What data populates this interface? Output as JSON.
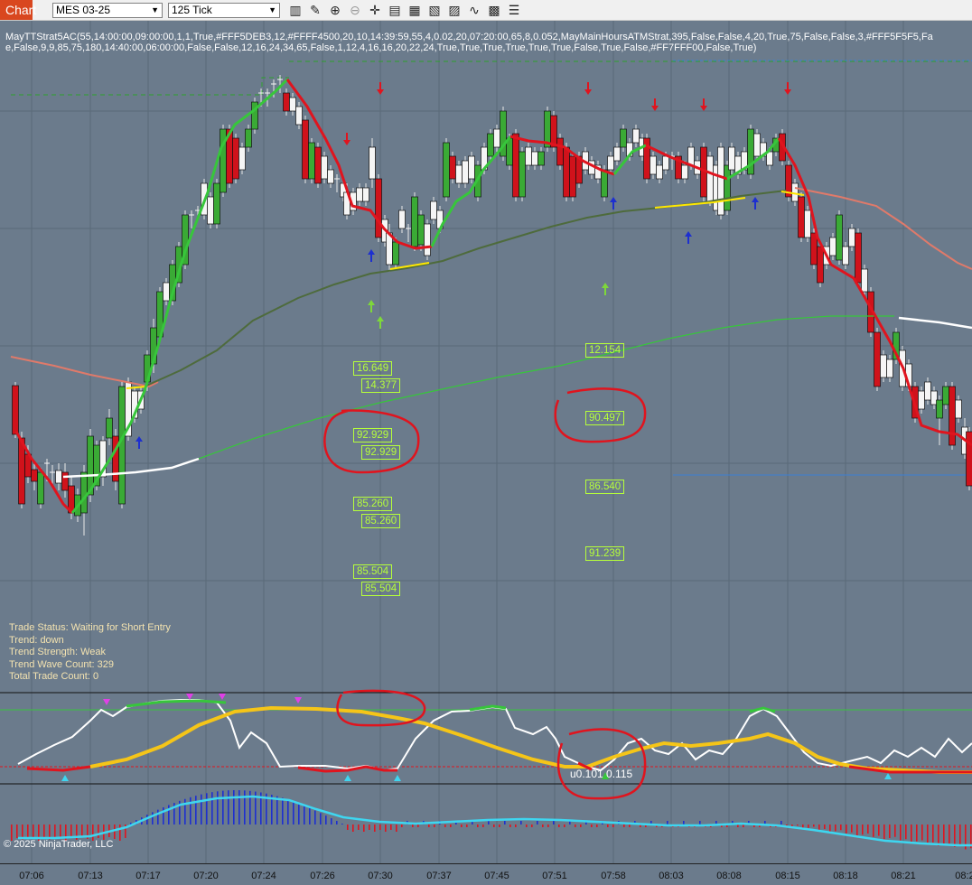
{
  "toolbar": {
    "tab_label": "Chart",
    "instrument": "MES 03-25",
    "interval": "125 Tick",
    "icons": [
      "bar-style-icon",
      "pencil-icon",
      "zoom-in-icon",
      "zoom-out-icon",
      "crosshair-icon",
      "properties-icon",
      "data-box-icon",
      "templates-icon",
      "strategies-icon",
      "indicators-icon",
      "analysis-icon",
      "more-icon"
    ]
  },
  "strategy_params": {
    "line1": "MayTTStrat5AC(55,14:00:00,09:00:00,1,1,True,#FFF5DEB3,12,#FFFF4500,20,10,14:39:59,55,4,0.02,20,07:20:00,65,8,0.052,MayMainHoursATMStrat,395,False,False,4,20,True,75,False,False,3,#FFF5F5F5,Fa",
    "line2": "e,False,9,9,85,75,180,14:40:00,06:00:00,False,False,12,16,24,34,65,False,1,12,4,16,16,20,22,24,True,True,True,True,True,True,False,True,False,#FF7FFF00,False,True)"
  },
  "value_boxes": {
    "left": [
      "16.649",
      "14.377",
      "92.929",
      "92.929",
      "85.260",
      "85.260",
      "85.504",
      "85.504"
    ],
    "right": [
      "12.154",
      "90.497",
      "86.540",
      "91.239"
    ]
  },
  "status": {
    "trade_status": "Trade Status: Waiting for Short Entry",
    "trend": "Trend: down",
    "trend_strength": "Trend Strength: Weak",
    "trend_wave_count": "Trend Wave Count: 329",
    "total_trade_count": "Total Trade Count: 0"
  },
  "oscillator_label": "u0.101  0.115",
  "copyright": "© 2025 NinjaTrader, LLC",
  "x_axis": {
    "ticks": [
      "07:06",
      "07:13",
      "07:17",
      "07:20",
      "07:24",
      "07:26",
      "07:30",
      "07:37",
      "07:45",
      "07:51",
      "07:58",
      "08:03",
      "08:08",
      "08:15",
      "08:18",
      "08:21",
      "08:2"
    ]
  },
  "colors": {
    "background": "#6b7b8c",
    "up_candle": "#3aaa35",
    "down_candle": "#d0121b",
    "value_box": "#b6ff3a",
    "status_text": "#f4e3b0",
    "annotation": "#e0141e"
  }
}
